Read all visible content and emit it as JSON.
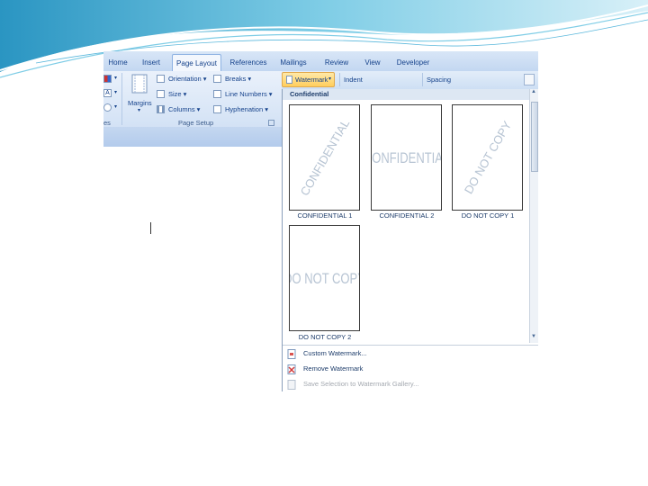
{
  "tabs": [
    {
      "label": "Home"
    },
    {
      "label": "Insert"
    },
    {
      "label": "Page Layout",
      "active": true
    },
    {
      "label": "References"
    },
    {
      "label": "Mailings"
    },
    {
      "label": "Review"
    },
    {
      "label": "View"
    },
    {
      "label": "Developer"
    }
  ],
  "page_setup": {
    "margins": "Margins",
    "orientation": "Orientation",
    "size": "Size",
    "columns": "Columns",
    "breaks": "Breaks",
    "line_numbers": "Line Numbers",
    "hyphenation": "Hyphenation",
    "group_label": "Page Setup",
    "prev_group_label": "es"
  },
  "paragraph_row": {
    "watermark": "Watermark",
    "indent": "Indent",
    "spacing": "Spacing"
  },
  "gallery": {
    "header": "Confidential",
    "items": [
      {
        "label": "CONFIDENTIAL 1",
        "text": "CONFIDENTIAL",
        "diagonal": true
      },
      {
        "label": "CONFIDENTIAL 2",
        "text": "CONFIDENTIAL",
        "diagonal": false
      },
      {
        "label": "DO NOT COPY 1",
        "text": "DO NOT COPY",
        "diagonal": true
      },
      {
        "label": "DO NOT COPY 2",
        "text": "DO NOT COPY",
        "diagonal": false
      }
    ]
  },
  "menu": {
    "custom": "Custom Watermark...",
    "remove": "Remove Watermark",
    "save": "Save Selection to Watermark Gallery..."
  },
  "colors": {
    "ribbon_text": "#15428b",
    "watermark_text": "#b7c4d3",
    "highlight": "#ffce5c",
    "slide_teal": "#3aa7d0"
  }
}
